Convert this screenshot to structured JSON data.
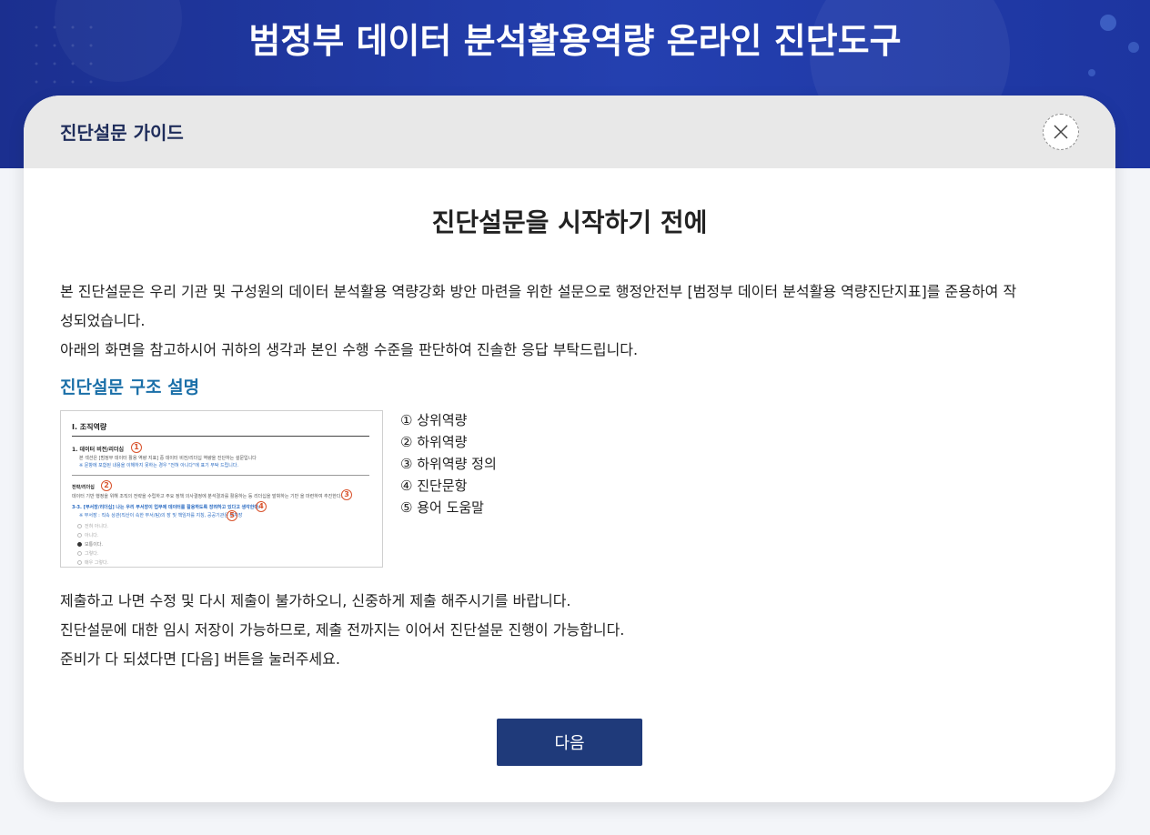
{
  "header": {
    "title": "범정부 데이터 분석활용역량 온라인 진단도구"
  },
  "modal": {
    "title": "진단설문 가이드",
    "close_icon": "close-icon",
    "heading": "진단설문을 시작하기 전에",
    "intro_line1": "본 진단설문은 우리 기관 및 구성원의 데이터 분석활용 역량강화 방안 마련을 위한 설문으로 행정안전부 [범정부 데이터 분석활용 역량진단지표]를 준용하여 작",
    "intro_line2": "성되었습니다.",
    "intro_line3": "아래의 화면을 참고하시어 귀하의 생각과 본인 수행 수준을 판단하여 진솔한 응답 부탁드립니다.",
    "structure_title": "진단설문 구조 설명",
    "legend": [
      "① 상위역량",
      "② 하위역량",
      "③ 하위역량 정의",
      "④ 진단문항",
      "⑤ 용어 도움말"
    ],
    "outro_line1": "제출하고 나면 수정 및 다시 제출이 불가하오니, 신중하게 제출 해주시기를 바랍니다.",
    "outro_line2": "진단설문에 대한 임시 저장이 가능하므로, 제출 전까지는 이어서 진단설문 진행이 가능합니다.",
    "outro_line3": "준비가 다 되셨다면 [다음] 버튼을 눌러주세요.",
    "next_button": "다음"
  },
  "thumbnail": {
    "section": "I. 조직역량",
    "item1": "1. 데이터 비전/리더십",
    "item1_desc": "본 섹션은 [범정부 데이터 활용 역량 지표] 중 데이터 비전/리더십 역량을 진단하는 설문입니다",
    "item1_note": "※ 문항에 포함된 내용을 이해하지 못하는 경우 \"전혀 아니다\"에 표기 부탁 드립니다.",
    "sub": "전략/리더십",
    "sub_desc": "데이터 기반 행정을 위해 조직의 전략을 수립하고 주요 정책 의사결정에 분석결과를 활용하는 등 리더십을 발휘하는 기반 을 마련하여 추진한다.",
    "question": "3-3. [부서장/리더십] 나는 우리 부서장이 업무에 데이터를 활용하도록 장려하고 있다고 생각한다.",
    "help": "※ 부서장 : 직속 상관(직산이 속한 부서/팀)의 장 및 책임자를 지칭, 공공기관은 부처장",
    "options": [
      "전혀 아니다.",
      "아니다.",
      "보통이다.",
      "그렇다.",
      "매우 그렇다."
    ],
    "markers": [
      "1",
      "2",
      "3",
      "4",
      "5"
    ]
  },
  "colors": {
    "header_bg": "#2440b0",
    "primary_button": "#1f3a7a",
    "section_title": "#1a6fa8",
    "marker": "#d9532c"
  }
}
